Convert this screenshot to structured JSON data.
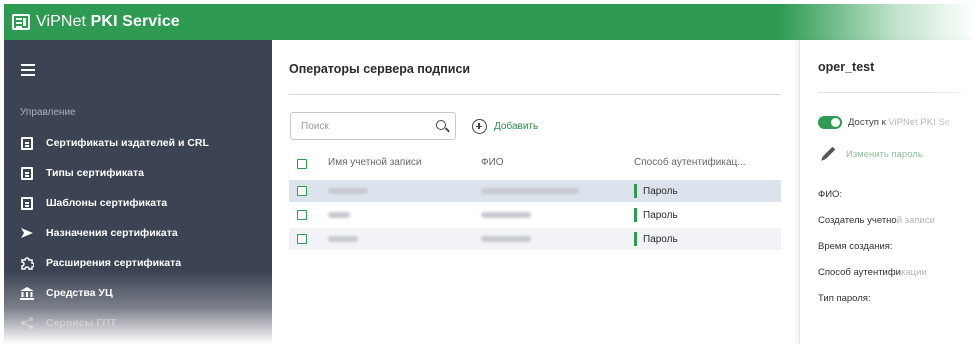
{
  "header": {
    "app_name_regular": "ViPNet",
    "app_name_bold": "PKI Service",
    "brand_color": "#2e9a52"
  },
  "sidebar": {
    "section_label": "Управление",
    "items": [
      {
        "label": "Сертификаты издателей и CRL",
        "icon": "certificate-icon"
      },
      {
        "label": "Типы сертификата",
        "icon": "document-icon"
      },
      {
        "label": "Шаблоны сертификата",
        "icon": "template-icon"
      },
      {
        "label": "Назначения сертификата",
        "icon": "send-icon"
      },
      {
        "label": "Расширения сертификата",
        "icon": "puzzle-icon"
      },
      {
        "label": "Средства УЦ",
        "icon": "bank-icon"
      },
      {
        "label": "Сервисы ГПТ",
        "icon": "share-icon"
      }
    ]
  },
  "main": {
    "title": "Операторы сервера подписи",
    "search_placeholder": "Поиск",
    "add_label": "Добавить",
    "columns": [
      "Имя учетной записи",
      "ФИО",
      "Способ аутентификац..."
    ],
    "rows": [
      {
        "account": "oper_test",
        "fio": "Петров Петр Петрович",
        "auth": "Пароль",
        "selected": true
      },
      {
        "account": "oper",
        "fio": "Оператор",
        "auth": "Пароль",
        "selected": false
      },
      {
        "account": "oper_alt",
        "fio": "Оператор",
        "auth": "Пароль",
        "selected": false
      }
    ]
  },
  "details": {
    "title": "oper_test",
    "access_label": "Доступ к ",
    "access_label_faded": "ViPNet PKI Se",
    "access_enabled": true,
    "edit_password_label": "Изменить пароль",
    "fields": [
      {
        "label": "ФИО:",
        "faded": ""
      },
      {
        "label": "Создатель учетно",
        "faded": "й записи"
      },
      {
        "label": "Время создания:",
        "faded": ""
      },
      {
        "label": "Способ аутентифи",
        "faded": "кации"
      },
      {
        "label": "Тип пароля:",
        "faded": ""
      }
    ]
  }
}
